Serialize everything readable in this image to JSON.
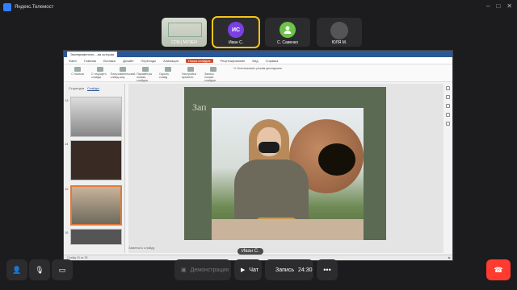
{
  "app": {
    "title": "Яндекс.Телемост"
  },
  "participants": [
    {
      "label": "СГМ.| МУЗЕЙ",
      "kind": "video"
    },
    {
      "label": "Иван С.",
      "initials": "ИС",
      "avatar_color": "#7b3fe4",
      "active": true
    },
    {
      "label": "С. Савенко",
      "initials": "",
      "avatar_color": "#6cc24a"
    },
    {
      "label": "ЮЛЯ М.",
      "kind": "video"
    }
  ],
  "presentation": {
    "tab_label": "Экспериментал...-ая история",
    "menu": [
      "Файл",
      "Главная",
      "Вставка",
      "Дизайн",
      "Переходы",
      "Анимация",
      "Показ слайдов",
      "Рецензирование",
      "Вид",
      "Справка"
    ],
    "menu_active": "Показ слайдов",
    "ribbon": [
      "С начала",
      "С текущего слайда",
      "Пользовательский слайд-шоу",
      "Параметры показа слайдов",
      "Скрыть слайд",
      "Настройка времени",
      "Запись показа слайдов"
    ],
    "ribbon_options": [
      "Использовать режим докладчика"
    ],
    "panel_tabs": [
      "Структура",
      "Слайды"
    ],
    "thumbs": [
      {
        "num": "13"
      },
      {
        "num": "14"
      },
      {
        "num": "15",
        "selected": true
      },
      {
        "num": "16"
      }
    ],
    "slide_title": "Зап",
    "notes_label": "Заметки к слайду",
    "status": "Слайд 15 из 35"
  },
  "speaker_label": "Иван С.",
  "controls": {
    "demo_label": "Демонстрация",
    "chat_label": "Чат",
    "record_label": "Запись",
    "record_time": "24:30"
  }
}
